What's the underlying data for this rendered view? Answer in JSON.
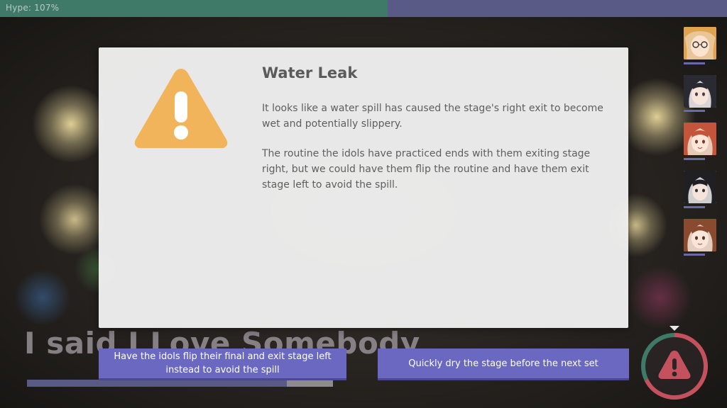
{
  "hype": {
    "label": "Hype: 107%",
    "fill_fraction": 0.533
  },
  "lyric": {
    "text": "I said I Love Somebody"
  },
  "song_progress": {
    "fraction": 0.85
  },
  "event": {
    "title": "Water Leak",
    "icon": "warning-triangle-icon",
    "paragraphs": [
      "It looks like a water spill has caused the stage's right exit to become wet and potentially slippery.",
      "The routine the idols have practiced ends with them exiting stage right, but we could have them flip the routine and have them exit stage left to avoid the spill."
    ]
  },
  "choices": [
    {
      "label": "Have the idols flip their final and exit stage left instead to avoid the spill"
    },
    {
      "label": "Quickly dry the stage before the next set"
    }
  ],
  "idols": [
    {
      "icon": "idol-portrait-1"
    },
    {
      "icon": "idol-portrait-2"
    },
    {
      "icon": "idol-portrait-3"
    },
    {
      "icon": "idol-portrait-4"
    },
    {
      "icon": "idol-portrait-5"
    }
  ],
  "timer": {
    "icon": "alert-timer-icon"
  },
  "colors": {
    "hype_fill": "#3f7a68",
    "hype_track": "#5a5a86",
    "button": "#6a68c0",
    "warning": "#f2b45a",
    "timer_ring_red": "#c4525e",
    "timer_ring_green": "#3f7a68"
  }
}
